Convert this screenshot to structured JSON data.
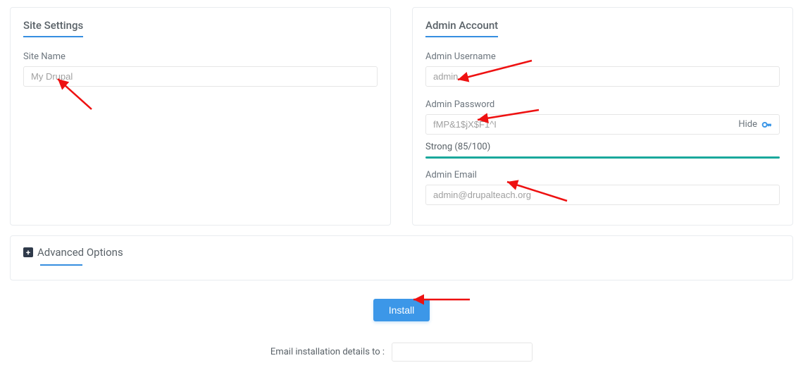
{
  "siteSettings": {
    "title": "Site Settings",
    "siteName": {
      "label": "Site Name",
      "value": "My Drupal"
    }
  },
  "adminAccount": {
    "title": "Admin Account",
    "username": {
      "label": "Admin Username",
      "value": "admin"
    },
    "password": {
      "label": "Admin Password",
      "value": "fMP&1$jX$F1^I",
      "hideLabel": "Hide"
    },
    "strength": {
      "text": "Strong (85/100)"
    },
    "email": {
      "label": "Admin Email",
      "value": "admin@drupalteach.org"
    }
  },
  "advanced": {
    "title": "Advanced Options"
  },
  "install": {
    "label": "Install"
  },
  "emailDetails": {
    "label": "Email installation details to :",
    "value": ""
  }
}
